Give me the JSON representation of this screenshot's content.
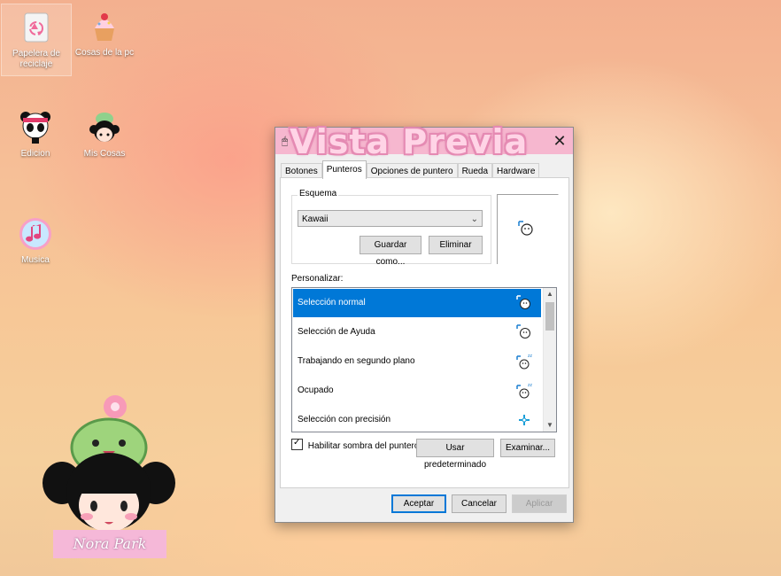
{
  "desktop": {
    "icons": [
      {
        "label": "Papelera de reciclaje",
        "icon": "recycle-bin-icon"
      },
      {
        "label": "Cosas de la pc",
        "icon": "cupcake-icon"
      },
      {
        "label": "Edicion",
        "icon": "panda-icon"
      },
      {
        "label": "Mis Cosas",
        "icon": "kawaii-girl-icon"
      },
      {
        "label": "Musica",
        "icon": "music-note-icon"
      }
    ],
    "sticker_name": "Nora Park"
  },
  "dialog": {
    "title": "Vista Previa",
    "close": "✕",
    "tabs": [
      {
        "label": "Botones"
      },
      {
        "label": "Punteros",
        "active": true
      },
      {
        "label": "Opciones de puntero"
      },
      {
        "label": "Rueda"
      },
      {
        "label": "Hardware"
      }
    ],
    "scheme": {
      "legend": "Esquema",
      "selected": "Kawaii",
      "save_label": "Guardar como...",
      "delete_label": "Eliminar"
    },
    "customize_label": "Personalizar:",
    "cursor_list": [
      {
        "label": "Selección normal",
        "selected": true,
        "icon": "cursor-normal-icon"
      },
      {
        "label": "Selección de Ayuda",
        "icon": "cursor-help-icon"
      },
      {
        "label": "Trabajando en segundo plano",
        "icon": "cursor-busy-bg-icon"
      },
      {
        "label": "Ocupado",
        "icon": "cursor-busy-icon"
      },
      {
        "label": "Selección con precisión",
        "icon": "crosshair-icon"
      }
    ],
    "shadow_checkbox": {
      "label": "Habilitar sombra del puntero",
      "checked": true
    },
    "default_label": "Usar predeterminado",
    "browse_label": "Examinar...",
    "ok_label": "Aceptar",
    "cancel_label": "Cancelar",
    "apply_label": "Aplicar",
    "colors": {
      "titlebar": "#f6b7cf",
      "selection": "#0078d7"
    }
  }
}
